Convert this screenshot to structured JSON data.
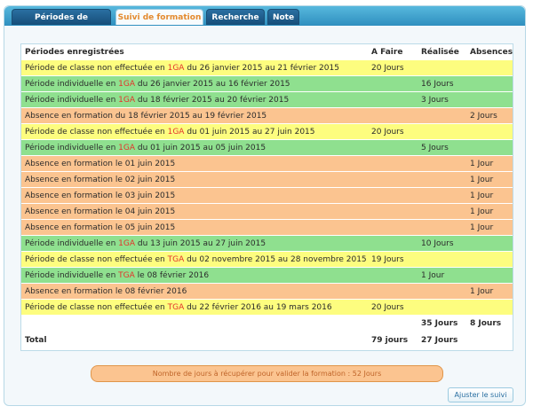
{
  "tabs": [
    {
      "label": "Périodes de formation"
    },
    {
      "label": "Suivi de formation"
    },
    {
      "label": "Recherche"
    },
    {
      "label": "Note"
    }
  ],
  "table": {
    "headers": {
      "periods": "Périodes enregistrées",
      "a_faire": "A Faire",
      "realisee": "Réalisée",
      "absences": "Absences"
    },
    "rows": [
      {
        "type": "classe",
        "prefix": "Période de classe non effectuée en ",
        "code": "1GA",
        "suffix": " du 26 janvier 2015 au 21 février 2015",
        "a_faire": "20 Jours",
        "realisee": "",
        "absences": ""
      },
      {
        "type": "individuelle",
        "prefix": "Période individuelle en ",
        "code": "1GA",
        "suffix": " du 26 janvier 2015 au 16 février 2015",
        "a_faire": "",
        "realisee": "16 Jours",
        "absences": ""
      },
      {
        "type": "individuelle",
        "prefix": "Période individuelle en ",
        "code": "1GA",
        "suffix": " du 18 février 2015 au 20 février 2015",
        "a_faire": "",
        "realisee": "3 Jours",
        "absences": ""
      },
      {
        "type": "absence",
        "prefix": "Absence en formation du 18 février 2015 au 19 février 2015",
        "code": "",
        "suffix": "",
        "a_faire": "",
        "realisee": "",
        "absences": "2 Jours"
      },
      {
        "type": "classe",
        "prefix": "Période de classe non effectuée en ",
        "code": "1GA",
        "suffix": " du 01 juin 2015 au 27 juin 2015",
        "a_faire": "20 Jours",
        "realisee": "",
        "absences": ""
      },
      {
        "type": "individuelle",
        "prefix": "Période individuelle en ",
        "code": "1GA",
        "suffix": " du 01 juin 2015 au 05 juin 2015",
        "a_faire": "",
        "realisee": "5 Jours",
        "absences": ""
      },
      {
        "type": "absence",
        "prefix": "Absence en formation le 01 juin 2015",
        "code": "",
        "suffix": "",
        "a_faire": "",
        "realisee": "",
        "absences": "1 Jour"
      },
      {
        "type": "absence",
        "prefix": "Absence en formation le 02 juin 2015",
        "code": "",
        "suffix": "",
        "a_faire": "",
        "realisee": "",
        "absences": "1 Jour"
      },
      {
        "type": "absence",
        "prefix": "Absence en formation le 03 juin 2015",
        "code": "",
        "suffix": "",
        "a_faire": "",
        "realisee": "",
        "absences": "1 Jour"
      },
      {
        "type": "absence",
        "prefix": "Absence en formation le 04 juin 2015",
        "code": "",
        "suffix": "",
        "a_faire": "",
        "realisee": "",
        "absences": "1 Jour"
      },
      {
        "type": "absence",
        "prefix": "Absence en formation le 05 juin 2015",
        "code": "",
        "suffix": "",
        "a_faire": "",
        "realisee": "",
        "absences": "1 Jour"
      },
      {
        "type": "individuelle",
        "prefix": "Période individuelle en ",
        "code": "1GA",
        "suffix": " du 13 juin 2015 au 27 juin 2015",
        "a_faire": "",
        "realisee": "10 Jours",
        "absences": ""
      },
      {
        "type": "classe",
        "prefix": "Période de classe non effectuée en ",
        "code": "TGA",
        "suffix": " du 02 novembre 2015 au 28 novembre 2015",
        "a_faire": "19 Jours",
        "realisee": "",
        "absences": ""
      },
      {
        "type": "individuelle",
        "prefix": "Période individuelle en ",
        "code": "TGA",
        "suffix": " le 08 février 2016",
        "a_faire": "",
        "realisee": "1 Jour",
        "absences": ""
      },
      {
        "type": "absence",
        "prefix": "Absence en formation le 08 février 2016",
        "code": "",
        "suffix": "",
        "a_faire": "",
        "realisee": "",
        "absences": "1 Jour"
      },
      {
        "type": "classe",
        "prefix": "Période de classe non effectuée en ",
        "code": "TGA",
        "suffix": " du 22 février 2016 au 19 mars 2016",
        "a_faire": "20 Jours",
        "realisee": "",
        "absences": ""
      }
    ],
    "subtotal": {
      "realisee": "35 Jours",
      "absences": "8 Jours"
    },
    "total": {
      "label": "Total",
      "a_faire": "79 jours",
      "realisee": "27 Jours"
    }
  },
  "notice": "Nombre de jours à récupérer pour valider la formation : 52 Jours",
  "add_button": "Ajuster le suivi"
}
